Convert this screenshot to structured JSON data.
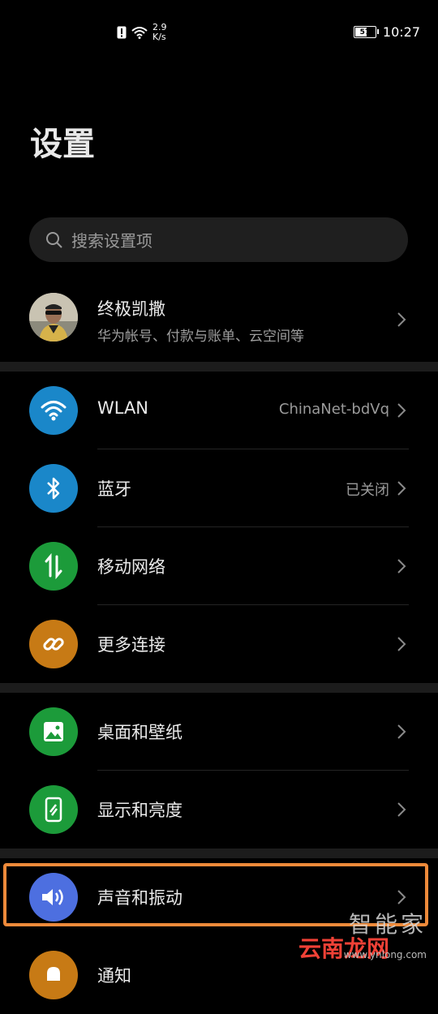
{
  "status_bar": {
    "net_speed_value": "2.9",
    "net_speed_unit": "K/s",
    "battery": "57",
    "time": "10:27"
  },
  "page_title": "设置",
  "search": {
    "placeholder": "搜索设置项"
  },
  "account": {
    "name": "终极凯撒",
    "subtitle": "华为帐号、付款与账单、云空间等"
  },
  "items": [
    {
      "label": "WLAN",
      "value": "ChinaNet-bdVq",
      "icon": "wifi-icon",
      "color": "#1a87c9"
    },
    {
      "label": "蓝牙",
      "value": "已关闭",
      "icon": "bluetooth-icon",
      "color": "#1a87c9"
    },
    {
      "label": "移动网络",
      "value": "",
      "icon": "mobile-data-icon",
      "color": "#1c9b3a"
    },
    {
      "label": "更多连接",
      "value": "",
      "icon": "link-icon",
      "color": "#c77a15"
    },
    {
      "label": "桌面和壁纸",
      "value": "",
      "icon": "wallpaper-icon",
      "color": "#1c9b3a"
    },
    {
      "label": "显示和亮度",
      "value": "",
      "icon": "display-icon",
      "color": "#1c9b3a"
    },
    {
      "label": "声音和振动",
      "value": "",
      "icon": "sound-icon",
      "color": "#4d6fe0"
    },
    {
      "label": "通知",
      "value": "",
      "icon": "notification-icon",
      "color": "#c77a15"
    }
  ],
  "watermark": {
    "line1": "智能家",
    "line2": "云南龙网",
    "line3": "www.ynlong.com"
  }
}
